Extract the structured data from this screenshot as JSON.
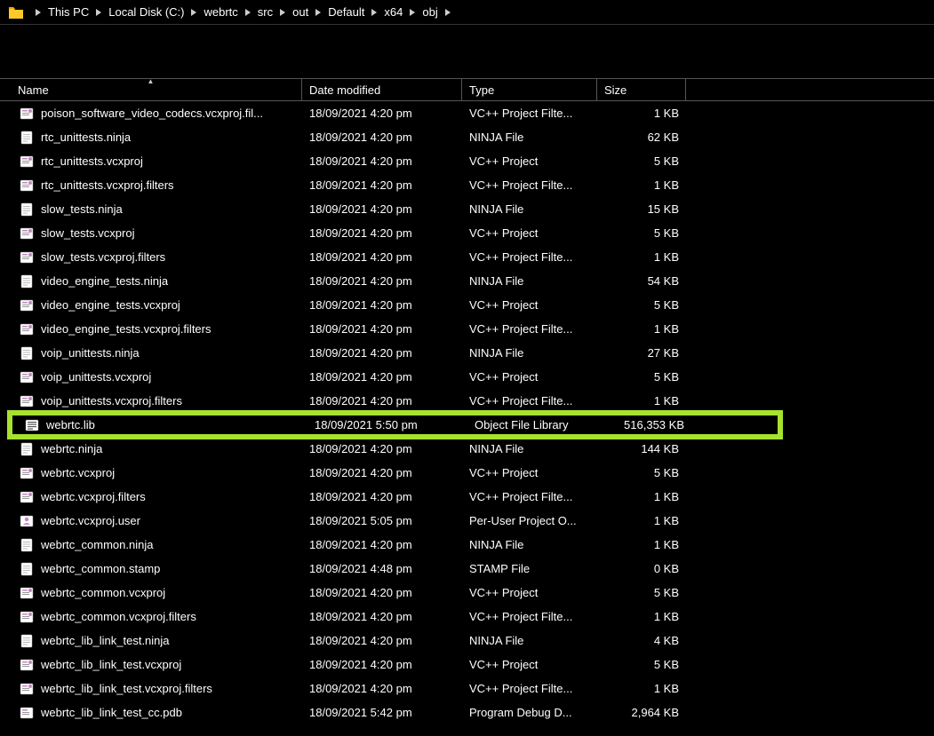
{
  "breadcrumb": [
    "This PC",
    "Local Disk (C:)",
    "webrtc",
    "src",
    "out",
    "Default",
    "x64",
    "obj"
  ],
  "columns": {
    "name": "Name",
    "date": "Date modified",
    "type": "Type",
    "size": "Size"
  },
  "rows": [
    {
      "name": "poison_software_video_codecs.vcxproj.fil...",
      "date": "18/09/2021 4:20 pm",
      "type": "VC++ Project Filte...",
      "size": "1 KB",
      "icon": "vcx"
    },
    {
      "name": "rtc_unittests.ninja",
      "date": "18/09/2021 4:20 pm",
      "type": "NINJA File",
      "size": "62 KB",
      "icon": "file"
    },
    {
      "name": "rtc_unittests.vcxproj",
      "date": "18/09/2021 4:20 pm",
      "type": "VC++ Project",
      "size": "5 KB",
      "icon": "vcx"
    },
    {
      "name": "rtc_unittests.vcxproj.filters",
      "date": "18/09/2021 4:20 pm",
      "type": "VC++ Project Filte...",
      "size": "1 KB",
      "icon": "vcx"
    },
    {
      "name": "slow_tests.ninja",
      "date": "18/09/2021 4:20 pm",
      "type": "NINJA File",
      "size": "15 KB",
      "icon": "file"
    },
    {
      "name": "slow_tests.vcxproj",
      "date": "18/09/2021 4:20 pm",
      "type": "VC++ Project",
      "size": "5 KB",
      "icon": "vcx"
    },
    {
      "name": "slow_tests.vcxproj.filters",
      "date": "18/09/2021 4:20 pm",
      "type": "VC++ Project Filte...",
      "size": "1 KB",
      "icon": "vcx"
    },
    {
      "name": "video_engine_tests.ninja",
      "date": "18/09/2021 4:20 pm",
      "type": "NINJA File",
      "size": "54 KB",
      "icon": "file"
    },
    {
      "name": "video_engine_tests.vcxproj",
      "date": "18/09/2021 4:20 pm",
      "type": "VC++ Project",
      "size": "5 KB",
      "icon": "vcx"
    },
    {
      "name": "video_engine_tests.vcxproj.filters",
      "date": "18/09/2021 4:20 pm",
      "type": "VC++ Project Filte...",
      "size": "1 KB",
      "icon": "vcx"
    },
    {
      "name": "voip_unittests.ninja",
      "date": "18/09/2021 4:20 pm",
      "type": "NINJA File",
      "size": "27 KB",
      "icon": "file"
    },
    {
      "name": "voip_unittests.vcxproj",
      "date": "18/09/2021 4:20 pm",
      "type": "VC++ Project",
      "size": "5 KB",
      "icon": "vcx"
    },
    {
      "name": "voip_unittests.vcxproj.filters",
      "date": "18/09/2021 4:20 pm",
      "type": "VC++ Project Filte...",
      "size": "1 KB",
      "icon": "vcx"
    },
    {
      "name": "webrtc.lib",
      "date": "18/09/2021 5:50 pm",
      "type": "Object File Library",
      "size": "516,353 KB",
      "icon": "lib",
      "highlight": true
    },
    {
      "name": "webrtc.ninja",
      "date": "18/09/2021 4:20 pm",
      "type": "NINJA File",
      "size": "144 KB",
      "icon": "file"
    },
    {
      "name": "webrtc.vcxproj",
      "date": "18/09/2021 4:20 pm",
      "type": "VC++ Project",
      "size": "5 KB",
      "icon": "vcx"
    },
    {
      "name": "webrtc.vcxproj.filters",
      "date": "18/09/2021 4:20 pm",
      "type": "VC++ Project Filte...",
      "size": "1 KB",
      "icon": "vcx"
    },
    {
      "name": "webrtc.vcxproj.user",
      "date": "18/09/2021 5:05 pm",
      "type": "Per-User Project O...",
      "size": "1 KB",
      "icon": "user"
    },
    {
      "name": "webrtc_common.ninja",
      "date": "18/09/2021 4:20 pm",
      "type": "NINJA File",
      "size": "1 KB",
      "icon": "file"
    },
    {
      "name": "webrtc_common.stamp",
      "date": "18/09/2021 4:48 pm",
      "type": "STAMP File",
      "size": "0 KB",
      "icon": "file"
    },
    {
      "name": "webrtc_common.vcxproj",
      "date": "18/09/2021 4:20 pm",
      "type": "VC++ Project",
      "size": "5 KB",
      "icon": "vcx"
    },
    {
      "name": "webrtc_common.vcxproj.filters",
      "date": "18/09/2021 4:20 pm",
      "type": "VC++ Project Filte...",
      "size": "1 KB",
      "icon": "vcx"
    },
    {
      "name": "webrtc_lib_link_test.ninja",
      "date": "18/09/2021 4:20 pm",
      "type": "NINJA File",
      "size": "4 KB",
      "icon": "file"
    },
    {
      "name": "webrtc_lib_link_test.vcxproj",
      "date": "18/09/2021 4:20 pm",
      "type": "VC++ Project",
      "size": "5 KB",
      "icon": "vcx"
    },
    {
      "name": "webrtc_lib_link_test.vcxproj.filters",
      "date": "18/09/2021 4:20 pm",
      "type": "VC++ Project Filte...",
      "size": "1 KB",
      "icon": "vcx"
    },
    {
      "name": "webrtc_lib_link_test_cc.pdb",
      "date": "18/09/2021 5:42 pm",
      "type": "Program Debug D...",
      "size": "2,964 KB",
      "icon": "pdb"
    }
  ]
}
